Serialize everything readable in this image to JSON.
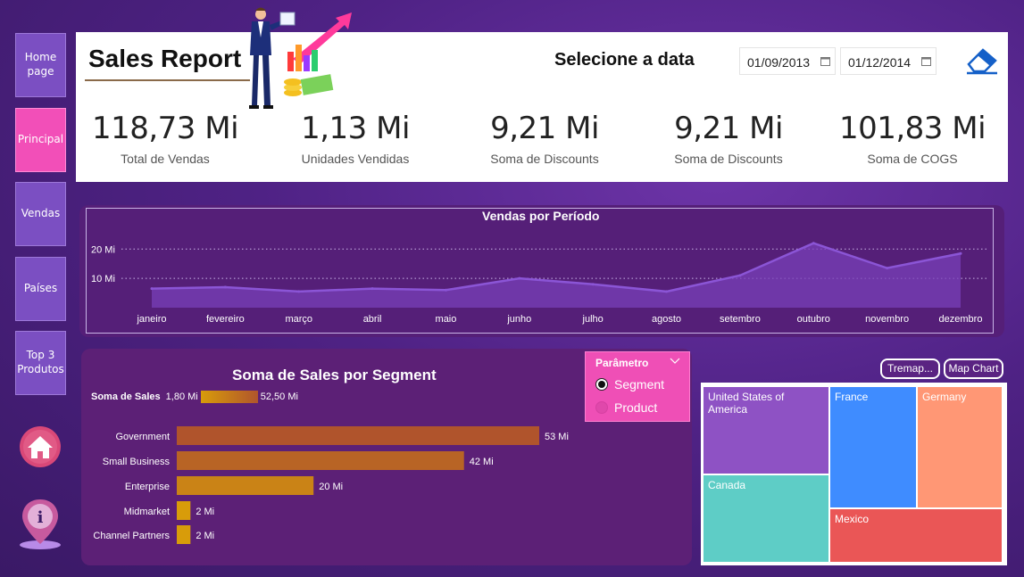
{
  "nav": {
    "items": [
      {
        "label": "Home page"
      },
      {
        "label": "Principal"
      },
      {
        "label": "Vendas"
      },
      {
        "label": "Países"
      },
      {
        "label": "Top 3 Produtos"
      }
    ]
  },
  "header": {
    "title": "Sales Report",
    "date_label": "Selecione a data",
    "date_start": "01/09/2013",
    "date_end": "01/12/2014"
  },
  "kpis": [
    {
      "value": "118,73 Mi",
      "label": "Total de Vendas"
    },
    {
      "value": "1,13 Mi",
      "label": "Unidades Vendidas"
    },
    {
      "value": "9,21 Mi",
      "label": "Soma de Discounts"
    },
    {
      "value": "9,21 Mi",
      "label": "Soma de Discounts"
    },
    {
      "value": "101,83 Mi",
      "label": "Soma de COGS"
    }
  ],
  "colors": {
    "accent_pink": "#f24fb8",
    "nav_purple": "#7b4fc2",
    "line": "#8b55d6",
    "bar_dark": "#b0552c",
    "bar_light": "#d89c0a"
  },
  "chart_data": [
    {
      "type": "area",
      "title": "Vendas por Período",
      "categories": [
        "janeiro",
        "fevereiro",
        "março",
        "abril",
        "maio",
        "junho",
        "julho",
        "agosto",
        "setembro",
        "outubro",
        "novembro",
        "dezembro"
      ],
      "values": [
        6.5,
        7.0,
        5.5,
        6.5,
        6.0,
        10.0,
        8.0,
        5.5,
        11.0,
        22.0,
        13.5,
        18.5
      ],
      "y_ticks": [
        "10 Mi",
        "20 Mi"
      ],
      "ylim": [
        0,
        28
      ],
      "grid": true
    },
    {
      "type": "bar",
      "title": "Soma de Sales por Segment",
      "legend_label": "Soma de  Sales",
      "legend_min": "1,80 Mi",
      "legend_max": "52,50 Mi",
      "categories": [
        "Government",
        "Small Business",
        "Enterprise",
        "Midmarket",
        "Channel Partners"
      ],
      "values": [
        53,
        42,
        20,
        2,
        2
      ],
      "value_labels": [
        "53 Mi",
        "42 Mi",
        "20 Mi",
        "2 Mi",
        "2 Mi"
      ],
      "xlim": [
        0,
        53
      ]
    }
  ],
  "parameter": {
    "title": "Parâmetro",
    "options": [
      {
        "label": "Segment",
        "selected": true
      },
      {
        "label": "Product",
        "selected": false
      }
    ]
  },
  "treemap": {
    "buttons": [
      "Tremap...",
      "Map Chart"
    ],
    "cells": [
      {
        "label": "United States of America",
        "color": "#8e52c4"
      },
      {
        "label": "France",
        "color": "#3f8cff"
      },
      {
        "label": "Germany",
        "color": "#ff9775"
      },
      {
        "label": "Canada",
        "color": "#5ecdc6"
      },
      {
        "label": "Mexico",
        "color": "#ea5656"
      }
    ]
  }
}
